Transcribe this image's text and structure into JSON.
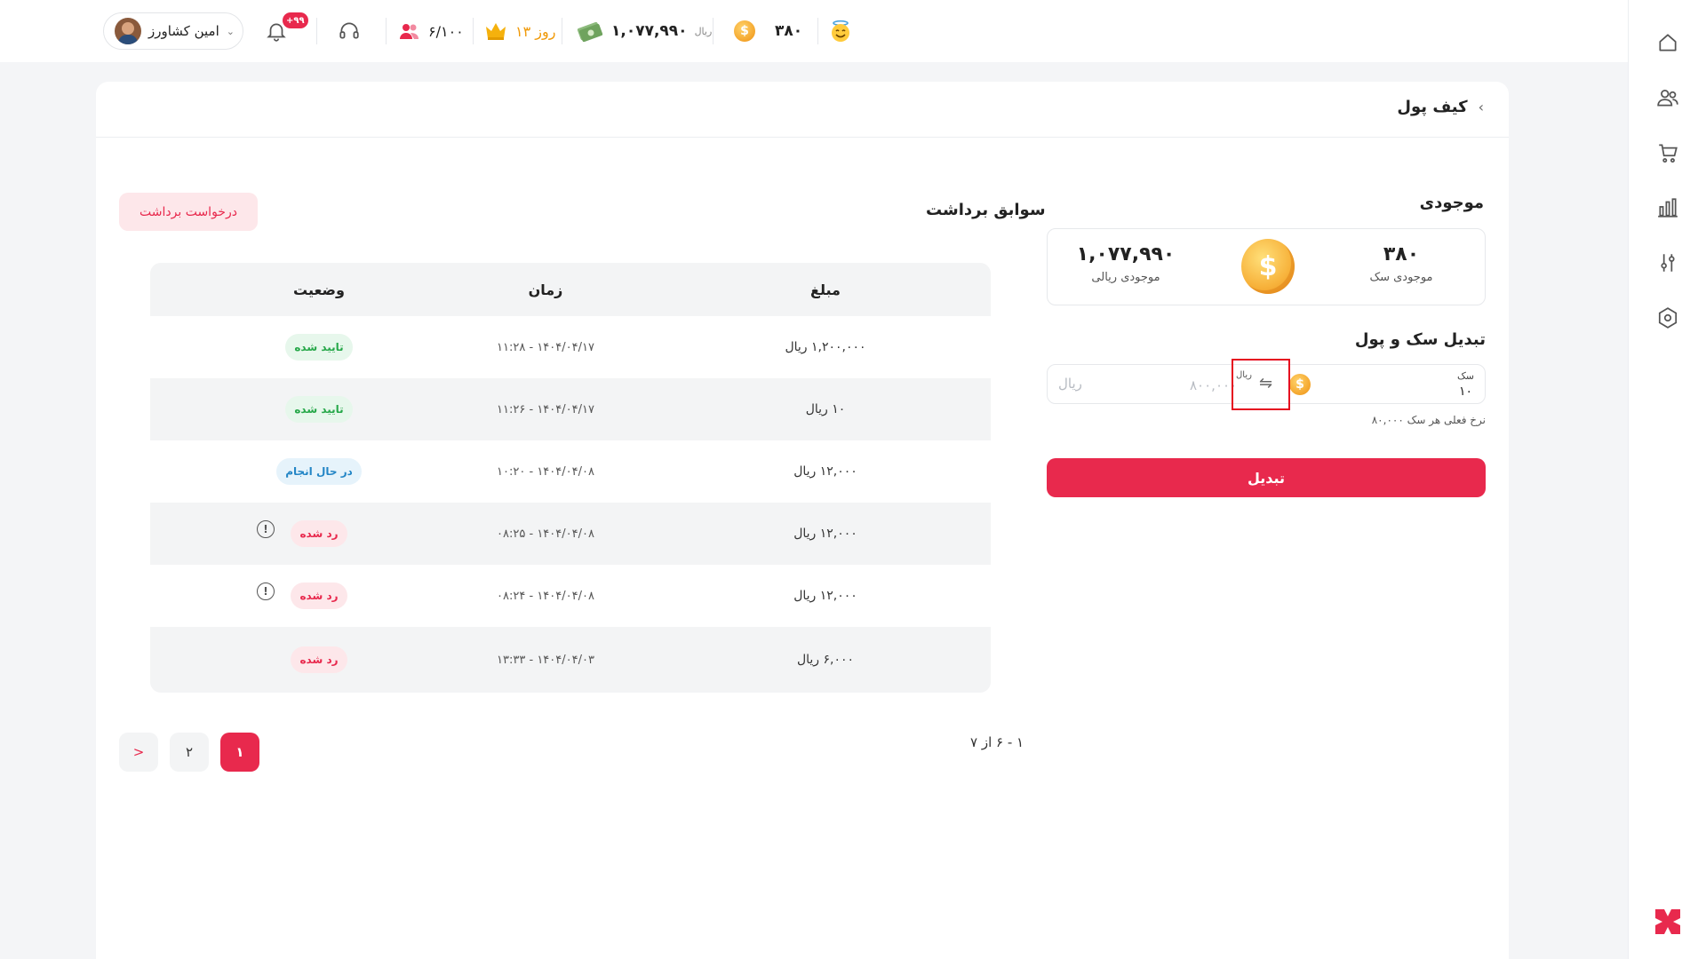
{
  "topbar": {
    "user_name": "امین کشاورز",
    "notification_badge": "+۹۹",
    "invites": "۶/۱۰۰",
    "subscription_days": "۱۳ روز",
    "wallet_amount": "۱,۰۷۷,۹۹۰",
    "wallet_unit": "ریال",
    "coins": "۳۸۰"
  },
  "breadcrumb": {
    "title": "کیف پول"
  },
  "balance": {
    "title": "موجودی",
    "coins_value": "۳۸۰",
    "coins_label": "موجودی سک",
    "rial_value": "۱,۰۷۷,۹۹۰",
    "rial_label": "موجودی ریالی"
  },
  "convert": {
    "title": "تبدیل سک و پول",
    "sekke_label": "سک",
    "sekke_value": "۱۰",
    "rial_label": "ریال",
    "rial_value": "۸۰۰,۰۰۰",
    "rial_placeholder": "ریال",
    "rate_text": "نرخ فعلی هر سک ۸۰,۰۰۰",
    "button_label": "تبدیل"
  },
  "withdrawals": {
    "title": "سوابق برداشت",
    "request_button": "درخواست برداشت",
    "columns": {
      "amount": "مبلغ",
      "time": "زمان",
      "status": "وضعیت"
    },
    "rows": [
      {
        "amount": "۱,۲۰۰,۰۰۰ ریال",
        "time": "۱۴۰۴/۰۴/۱۷ - ۱۱:۲۸",
        "status": "تایید شده"
      },
      {
        "amount": "۱۰ ریال",
        "time": "۱۴۰۴/۰۴/۱۷ - ۱۱:۲۶",
        "status": "تایید شده"
      },
      {
        "amount": "۱۲,۰۰۰ ریال",
        "time": "۱۴۰۴/۰۴/۰۸ - ۱۰:۲۰",
        "status": "در حال انجام"
      },
      {
        "amount": "۱۲,۰۰۰ ریال",
        "time": "۱۴۰۴/۰۴/۰۸ - ۰۸:۲۵",
        "status": "رد شده"
      },
      {
        "amount": "۱۲,۰۰۰ ریال",
        "time": "۱۴۰۴/۰۴/۰۸ - ۰۸:۲۴",
        "status": "رد شده"
      },
      {
        "amount": "۶,۰۰۰ ریال",
        "time": "۱۴۰۴/۰۴/۰۳ - ۱۳:۳۳",
        "status": "رد شده"
      }
    ],
    "range_text": "۱ - ۶ از ۷",
    "pages": [
      "۱",
      "۲"
    ],
    "next_label": ">"
  },
  "colors": {
    "accent": "#e8294d",
    "success": "#27a84a",
    "info": "#2486c6"
  },
  "icons": {
    "rail": [
      "home-icon",
      "users-icon",
      "cart-icon",
      "chart-icon",
      "sliders-icon",
      "settings-icon"
    ]
  }
}
